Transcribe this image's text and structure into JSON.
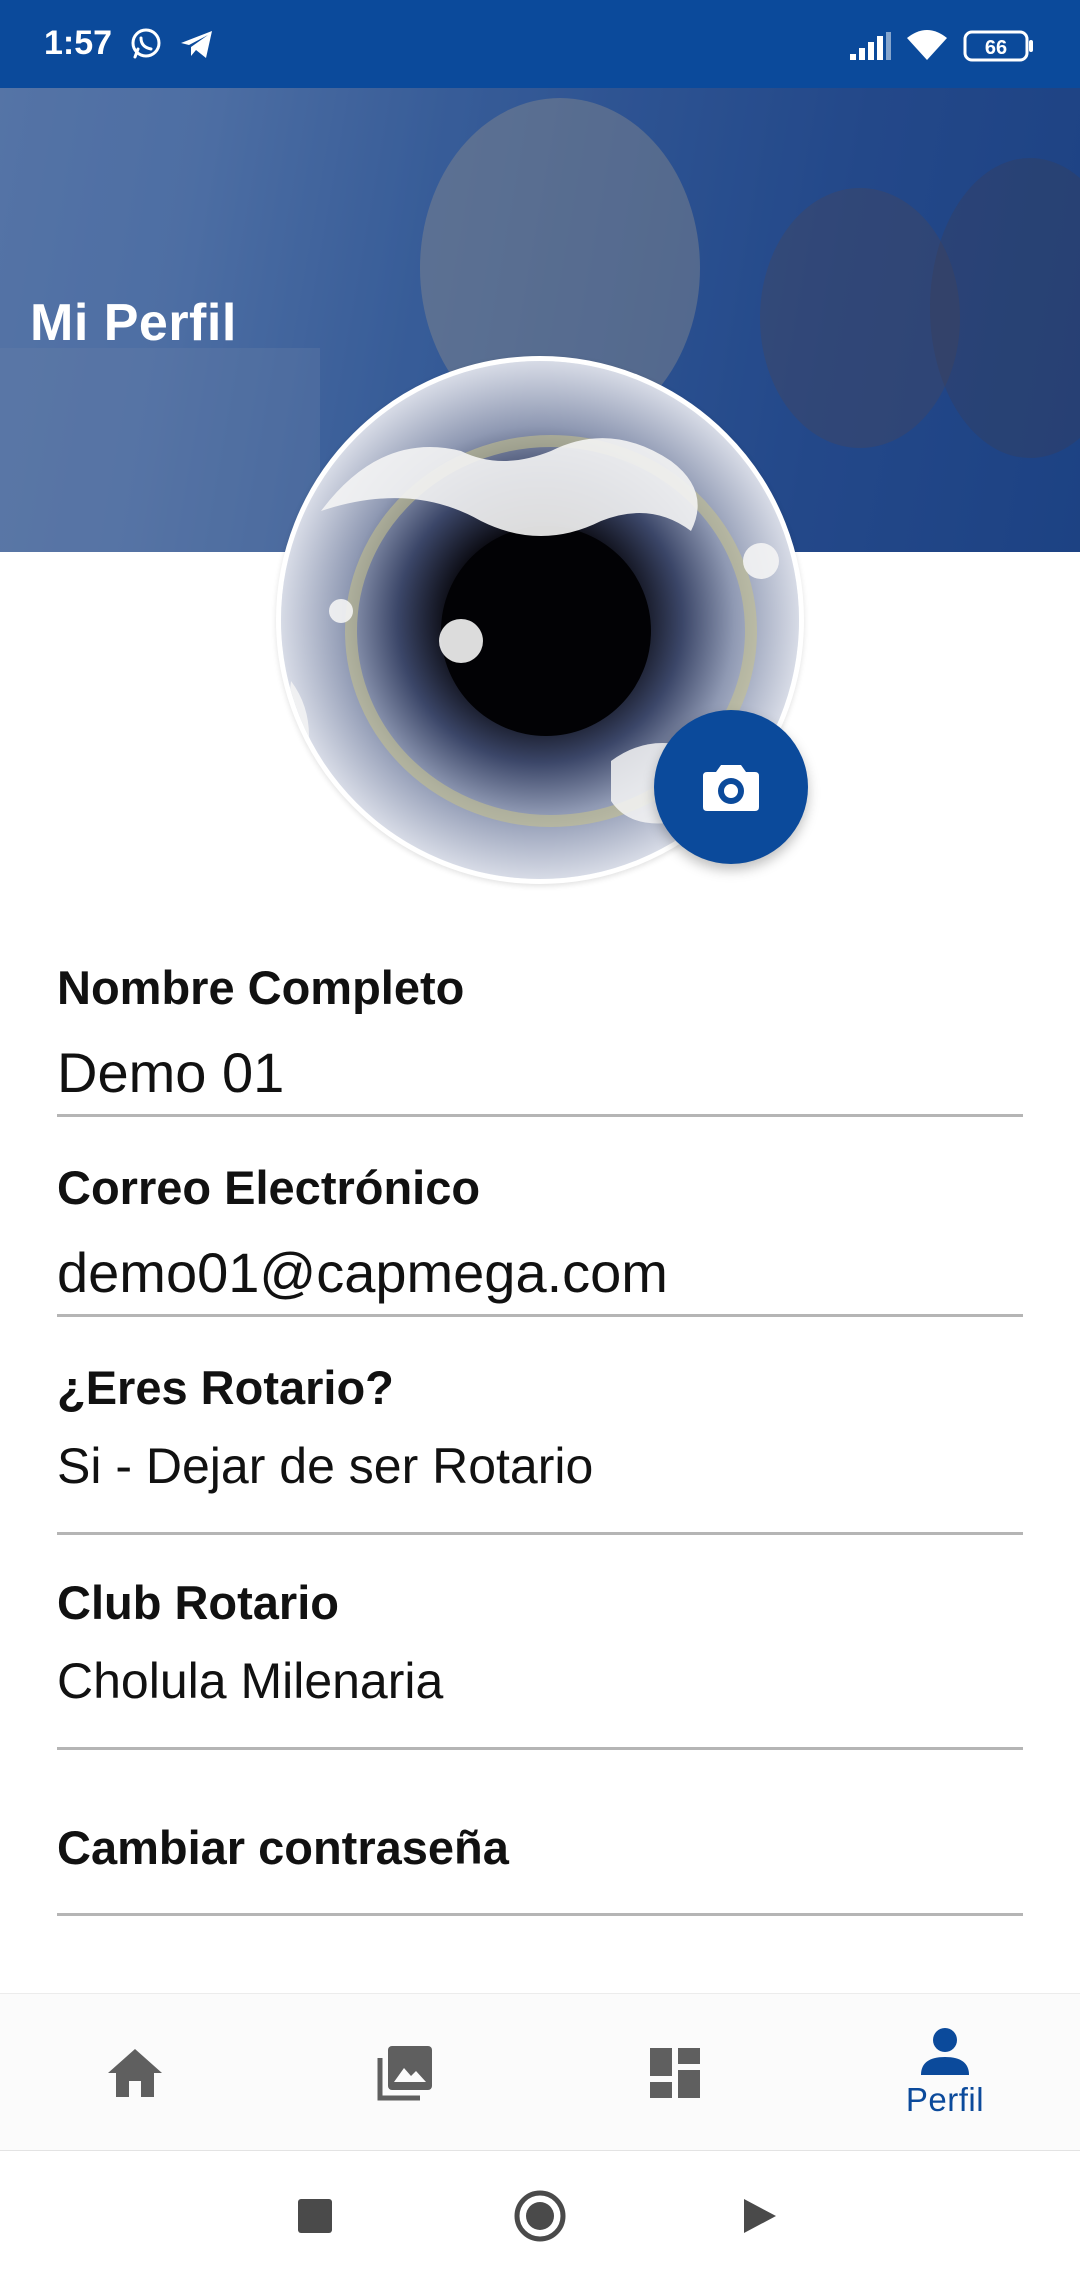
{
  "status_bar": {
    "time": "1:57",
    "battery": "66",
    "icons": [
      "whatsapp-icon",
      "telegram-icon",
      "signal-icon",
      "wifi-icon",
      "battery-icon"
    ]
  },
  "header": {
    "title": "Mi Perfil"
  },
  "profile": {
    "camera_icon": "camera-icon"
  },
  "fields": [
    {
      "label": "Nombre Completo",
      "value": "Demo 01"
    },
    {
      "label": "Correo Electrónico",
      "value": "demo01@capmega.com"
    },
    {
      "label": "¿Eres Rotario?",
      "value": "Si - Dejar de ser Rotario"
    },
    {
      "label": "Club Rotario",
      "value": "Cholula Milenaria"
    },
    {
      "label": "Cambiar contraseña",
      "value": ""
    }
  ],
  "bottom_nav": {
    "items": [
      {
        "icon": "home-icon",
        "label": ""
      },
      {
        "icon": "gallery-icon",
        "label": ""
      },
      {
        "icon": "dashboard-icon",
        "label": ""
      },
      {
        "icon": "person-icon",
        "label": "Perfil",
        "active": true
      }
    ]
  },
  "colors": {
    "primary": "#0b4a9b",
    "inactive_icon": "#5f5f5f",
    "divider": "#b5b5b5"
  }
}
